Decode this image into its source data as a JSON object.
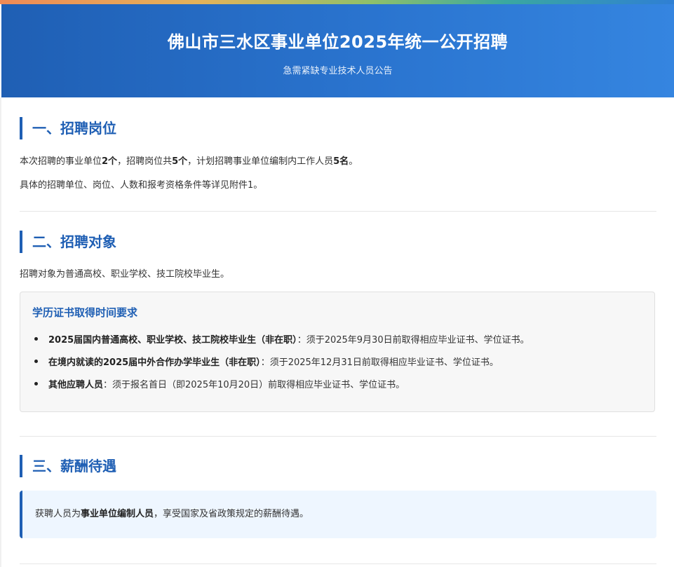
{
  "header": {
    "title": "佛山市三水区事业单位2025年统一公开招聘",
    "subtitle": "急需紧缺专业技术人员公告"
  },
  "section1": {
    "title": "一、招聘岗位",
    "p1_a": "本次招聘的事业单位",
    "p1_b": "2个",
    "p1_c": "，招聘岗位共",
    "p1_d": "5个",
    "p1_e": "，计划招聘事业单位编制内工作人员",
    "p1_f": "5名",
    "p1_g": "。",
    "p2": "具体的招聘单位、岗位、人数和报考资格条件等详见附件1。"
  },
  "section2": {
    "title": "二、招聘对象",
    "p1": "招聘对象为普通高校、职业学校、技工院校毕业生。",
    "box": {
      "title": "学历证书取得时间要求",
      "items": [
        {
          "bold": "2025届国内普通高校、职业学校、技工院校毕业生（非在职）",
          "text": "：须于2025年9月30日前取得相应毕业证书、学位证书。"
        },
        {
          "bold": "在境内就读的2025届中外合作办学毕业生（非在职）",
          "text": "：须于2025年12月31日前取得相应毕业证书、学位证书。"
        },
        {
          "bold": "其他应聘人员",
          "text": "：须于报名首日（即2025年10月20日）前取得相应毕业证书、学位证书。"
        }
      ]
    }
  },
  "section3": {
    "title": "三、薪酬待遇",
    "text_a": "获聘人员为",
    "text_b": "事业单位编制人员",
    "text_c": "，享受国家及省政策规定的薪酬待遇。"
  },
  "colors": {
    "accent": "#1f5fb4",
    "header_start": "#1f5fb4",
    "header_end": "#3585e0",
    "box_bg": "#f7f7f7",
    "pay_bg": "#eef6ff"
  }
}
